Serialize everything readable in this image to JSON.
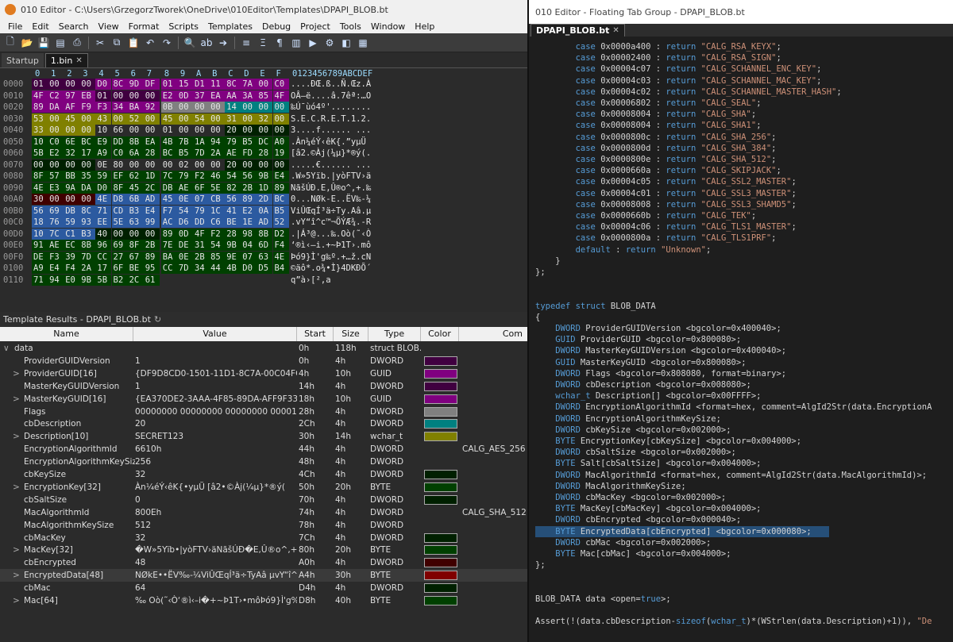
{
  "left": {
    "title": "010 Editor - C:\\Users\\GrzegorzTworek\\OneDrive\\010Editor\\Templates\\DPAPI_BLOB.bt",
    "menu": [
      "File",
      "Edit",
      "Search",
      "View",
      "Format",
      "Scripts",
      "Templates",
      "Debug",
      "Project",
      "Tools",
      "Window",
      "Help"
    ],
    "tabs": [
      {
        "label": "Startup"
      },
      {
        "label": "1.bin"
      }
    ],
    "close_glyph": "✕",
    "hex_header_cols": [
      "0",
      "1",
      "2",
      "3",
      "4",
      "5",
      "6",
      "7",
      "8",
      "9",
      "A",
      "B",
      "C",
      "D",
      "E",
      "F"
    ],
    "ascii_header": "0123456789ABCDEF",
    "hex_rows": [
      {
        "addr": "0000",
        "bytes": [
          "01",
          "00",
          "00",
          "00",
          "D0",
          "8C",
          "9D",
          "DF",
          "01",
          "15",
          "D1",
          "11",
          "8C",
          "7A",
          "00",
          "C0"
        ],
        "ascii": "....ÐŒ.ß..Ñ.Œz.À"
      },
      {
        "addr": "0010",
        "bytes": [
          "4F",
          "C2",
          "97",
          "EB",
          "01",
          "00",
          "00",
          "00",
          "E2",
          "0D",
          "37",
          "EA",
          "AA",
          "3A",
          "85",
          "4F"
        ],
        "ascii": "OÂ—ë....â.7êª:…O"
      },
      {
        "addr": "0020",
        "bytes": [
          "89",
          "DA",
          "AF",
          "F9",
          "F3",
          "34",
          "BA",
          "92",
          "0B",
          "00",
          "00",
          "00",
          "14",
          "00",
          "00",
          "00"
        ],
        "ascii": "‰Ú¯ùó4º'........"
      },
      {
        "addr": "0030",
        "bytes": [
          "53",
          "00",
          "45",
          "00",
          "43",
          "00",
          "52",
          "00",
          "45",
          "00",
          "54",
          "00",
          "31",
          "00",
          "32",
          "00"
        ],
        "ascii": "S.E.C.R.E.T.1.2."
      },
      {
        "addr": "0040",
        "bytes": [
          "33",
          "00",
          "00",
          "00",
          "10",
          "66",
          "00",
          "00",
          "01",
          "00",
          "00",
          "00",
          "20",
          "00",
          "00",
          "00"
        ],
        "ascii": "3....f...... ..."
      },
      {
        "addr": "0050",
        "bytes": [
          "10",
          "C0",
          "6E",
          "BC",
          "E9",
          "DD",
          "8B",
          "EA",
          "4B",
          "7B",
          "1A",
          "94",
          "79",
          "B5",
          "DC",
          "A0"
        ],
        "ascii": ".Àn¼éÝ‹êK{.”yµÜ "
      },
      {
        "addr": "0060",
        "bytes": [
          "5B",
          "E2",
          "32",
          "17",
          "A9",
          "C0",
          "6A",
          "28",
          "BC",
          "B5",
          "7D",
          "2A",
          "AE",
          "FD",
          "28",
          "19"
        ],
        "ascii": "[â2.©Àj(¼µ}*®ý(."
      },
      {
        "addr": "0070",
        "bytes": [
          "00",
          "00",
          "00",
          "00",
          "0E",
          "80",
          "00",
          "00",
          "00",
          "02",
          "00",
          "00",
          "20",
          "00",
          "00",
          "00"
        ],
        "ascii": ".....€...... ..."
      },
      {
        "addr": "0080",
        "bytes": [
          "8F",
          "57",
          "BB",
          "35",
          "59",
          "EF",
          "62",
          "1D",
          "7C",
          "79",
          "F2",
          "46",
          "54",
          "56",
          "9B",
          "E4"
        ],
        "ascii": ".W»5Yïb.|yòFTV›ä"
      },
      {
        "addr": "0090",
        "bytes": [
          "4E",
          "E3",
          "9A",
          "DA",
          "D0",
          "8F",
          "45",
          "2C",
          "DB",
          "AE",
          "6F",
          "5E",
          "82",
          "2B",
          "1D",
          "89"
        ],
        "ascii": "NãšÚÐ.E,Û®o^‚+.‰"
      },
      {
        "addr": "00A0",
        "bytes": [
          "30",
          "00",
          "00",
          "00",
          "4E",
          "D8",
          "6B",
          "AD",
          "45",
          "0E",
          "07",
          "CB",
          "56",
          "89",
          "2D",
          "BC"
        ],
        "ascii": "0...NØk-E..ËV‰-¼"
      },
      {
        "addr": "00B0",
        "bytes": [
          "56",
          "69",
          "DB",
          "8C",
          "71",
          "CD",
          "B3",
          "E4",
          "F7",
          "54",
          "79",
          "1C",
          "41",
          "E2",
          "0A",
          "B5"
        ],
        "ascii": "ViÛŒqÍ³ä÷Ty.Aâ.µ"
      },
      {
        "addr": "00C0",
        "bytes": [
          "18",
          "76",
          "59",
          "93",
          "EE",
          "5E",
          "63",
          "99",
          "AC",
          "D6",
          "DD",
          "C6",
          "BE",
          "1E",
          "AD",
          "52"
        ],
        "ascii": ".vY“î^c™¬ÖÝÆ¾.-R"
      },
      {
        "addr": "00D0",
        "bytes": [
          "10",
          "7C",
          "C1",
          "B3",
          "40",
          "00",
          "00",
          "00",
          "89",
          "0D",
          "4F",
          "F2",
          "28",
          "98",
          "8B",
          "D2"
        ],
        "ascii": ".|Á³@...‰.Oò(˜‹Ò"
      },
      {
        "addr": "00E0",
        "bytes": [
          "91",
          "AE",
          "EC",
          "8B",
          "96",
          "69",
          "8F",
          "2B",
          "7E",
          "DE",
          "31",
          "54",
          "9B",
          "04",
          "6D",
          "F4"
        ],
        "ascii": "‘®ì‹–i.+~Þ1T›.mô"
      },
      {
        "addr": "00F0",
        "bytes": [
          "DE",
          "F3",
          "39",
          "7D",
          "CC",
          "27",
          "67",
          "89",
          "BA",
          "0E",
          "2B",
          "85",
          "9E",
          "07",
          "63",
          "4E"
        ],
        "ascii": "Þó9}Ì'g‰º.+…ž.cN"
      },
      {
        "addr": "0100",
        "bytes": [
          "A9",
          "E4",
          "F4",
          "2A",
          "17",
          "6F",
          "BE",
          "95",
          "CC",
          "7D",
          "34",
          "44",
          "4B",
          "D0",
          "D5",
          "B4"
        ],
        "ascii": "©äô*.o¾•Ì}4DKÐÕ´"
      },
      {
        "addr": "0110",
        "bytes": [
          "71",
          "94",
          "E0",
          "9B",
          "5B",
          "B2",
          "2C",
          "61"
        ],
        "ascii": "q”à›[²,a"
      }
    ],
    "results_title": "Template Results - DPAPI_BLOB.bt",
    "results_headers": [
      "Name",
      "Value",
      "Start",
      "Size",
      "Type",
      "Color",
      "Com"
    ],
    "results_rows": [
      {
        "name": "data",
        "value": "",
        "start": "0h",
        "size": "118h",
        "type": "struct BLOB...",
        "color": "",
        "comment": "",
        "tw": "∨",
        "indent": 0
      },
      {
        "name": "ProviderGUIDVersion",
        "value": "1",
        "start": "0h",
        "size": "4h",
        "type": "DWORD",
        "color": "#400040",
        "comment": "",
        "tw": "",
        "indent": 1
      },
      {
        "name": "ProviderGUID[16]",
        "value": "{DF9D8CD0-1501-11D1-8C7A-00C04FC297EB}",
        "start": "4h",
        "size": "10h",
        "type": "GUID",
        "color": "#800080",
        "comment": "",
        "tw": ">",
        "indent": 1
      },
      {
        "name": "MasterKeyGUIDVersion",
        "value": "1",
        "start": "14h",
        "size": "4h",
        "type": "DWORD",
        "color": "#400040",
        "comment": "",
        "tw": "",
        "indent": 1
      },
      {
        "name": "MasterKeyGUID[16]",
        "value": "{EA370DE2-3AAA-4F85-89DA-AFF9F334BA92}",
        "start": "18h",
        "size": "10h",
        "type": "GUID",
        "color": "#800080",
        "comment": "",
        "tw": ">",
        "indent": 1
      },
      {
        "name": "Flags",
        "value": "00000000 00000000 00000000 00001011,b",
        "start": "28h",
        "size": "4h",
        "type": "DWORD",
        "color": "#808080",
        "comment": "",
        "tw": "",
        "indent": 1
      },
      {
        "name": "cbDescription",
        "value": "20",
        "start": "2Ch",
        "size": "4h",
        "type": "DWORD",
        "color": "#008080",
        "comment": "",
        "tw": "",
        "indent": 1
      },
      {
        "name": "Description[10]",
        "value": "SECRET123",
        "start": "30h",
        "size": "14h",
        "type": "wchar_t",
        "color": "#808000",
        "comment": "",
        "tw": ">",
        "indent": 1
      },
      {
        "name": "EncryptionAlgorithmId",
        "value": "6610h",
        "start": "44h",
        "size": "4h",
        "type": "DWORD",
        "color": "",
        "comment": "CALG_AES_256",
        "tw": "",
        "indent": 1
      },
      {
        "name": "EncryptionAlgorithmKeySize",
        "value": "256",
        "start": "48h",
        "size": "4h",
        "type": "DWORD",
        "color": "",
        "comment": "",
        "tw": "",
        "indent": 1
      },
      {
        "name": "cbKeySize",
        "value": "32",
        "start": "4Ch",
        "size": "4h",
        "type": "DWORD",
        "color": "#002000",
        "comment": "",
        "tw": "",
        "indent": 1
      },
      {
        "name": "EncryptionKey[32]",
        "value": "Àn¼éÝ‹êK{•yµÜ [â2•©Àj(¼µ}*®ý(",
        "start": "50h",
        "size": "20h",
        "type": "BYTE",
        "color": "#004000",
        "comment": "",
        "tw": ">",
        "indent": 1
      },
      {
        "name": "cbSaltSize",
        "value": "0",
        "start": "70h",
        "size": "4h",
        "type": "DWORD",
        "color": "#002000",
        "comment": "",
        "tw": "",
        "indent": 1
      },
      {
        "name": "MacAlgorithmId",
        "value": "800Eh",
        "start": "74h",
        "size": "4h",
        "type": "DWORD",
        "color": "",
        "comment": "CALG_SHA_512",
        "tw": "",
        "indent": 1
      },
      {
        "name": "MacAlgorithmKeySize",
        "value": "512",
        "start": "78h",
        "size": "4h",
        "type": "DWORD",
        "color": "",
        "comment": "",
        "tw": "",
        "indent": 1
      },
      {
        "name": "cbMacKey",
        "value": "32",
        "start": "7Ch",
        "size": "4h",
        "type": "DWORD",
        "color": "#002000",
        "comment": "",
        "tw": "",
        "indent": 1
      },
      {
        "name": "MacKey[32]",
        "value": "�W»5Yïb•|yòFTV›äNãšÚÐ�E,Û®o^‚+•‰",
        "start": "80h",
        "size": "20h",
        "type": "BYTE",
        "color": "#004000",
        "comment": "",
        "tw": ">",
        "indent": 1
      },
      {
        "name": "cbEncrypted",
        "value": "48",
        "start": "A0h",
        "size": "4h",
        "type": "DWORD",
        "color": "#400000",
        "comment": "",
        "tw": "",
        "indent": 1
      },
      {
        "name": "EncryptedData[48]",
        "value": "NØkE••ËV‰-¼ViÛŒqÍ³ä÷TyAâ µvY“î^...",
        "start": "A4h",
        "size": "30h",
        "type": "BYTE",
        "color": "#800000",
        "comment": "",
        "tw": ">",
        "indent": 1
      },
      {
        "name": "cbMac",
        "value": "64",
        "start": "D4h",
        "size": "4h",
        "type": "DWORD",
        "color": "#002000",
        "comment": "",
        "tw": "",
        "indent": 1
      },
      {
        "name": "Mac[64]",
        "value": "‰ Oò(˜‹Ò‘®ì‹–i�+~Þ1T›•môÞó9}Ì'g‰º•+...",
        "start": "D8h",
        "size": "40h",
        "type": "BYTE",
        "color": "#004000",
        "comment": "",
        "tw": ">",
        "indent": 1
      }
    ]
  },
  "right": {
    "title": "010 Editor - Floating Tab Group - DPAPI_BLOB.bt",
    "tab": "DPAPI_BLOB.bt",
    "code_lines": [
      "        case 0x0000a400 : return \"CALG_RSA_KEYX\";",
      "        case 0x00002400 : return \"CALG_RSA_SIGN\";",
      "        case 0x00004c07 : return \"CALG_SCHANNEL_ENC_KEY\";",
      "        case 0x00004c03 : return \"CALG_SCHANNEL_MAC_KEY\";",
      "        case 0x00004c02 : return \"CALG_SCHANNEL_MASTER_HASH\";",
      "        case 0x00006802 : return \"CALG_SEAL\";",
      "        case 0x00008004 : return \"CALG_SHA\";",
      "        case 0x00008004 : return \"CALG_SHA1\";",
      "        case 0x0000800c : return \"CALG_SHA_256\";",
      "        case 0x0000800d : return \"CALG_SHA_384\";",
      "        case 0x0000800e : return \"CALG_SHA_512\";",
      "        case 0x0000660a : return \"CALG_SKIPJACK\";",
      "        case 0x00004c05 : return \"CALG_SSL2_MASTER\";",
      "        case 0x00004c01 : return \"CALG_SSL3_MASTER\";",
      "        case 0x00008008 : return \"CALG_SSL3_SHAMD5\";",
      "        case 0x0000660b : return \"CALG_TEK\";",
      "        case 0x00004c06 : return \"CALG_TLS1_MASTER\";",
      "        case 0x0000800a : return \"CALG_TLS1PRF\";",
      "        default : return \"Unknown\";",
      "    }",
      "};",
      "",
      "",
      "typedef struct BLOB_DATA",
      "{",
      "    DWORD ProviderGUIDVersion <bgcolor=0x400040>;",
      "    GUID ProviderGUID <bgcolor=0x800080>;",
      "    DWORD MasterKeyGUIDVersion <bgcolor=0x400040>;",
      "    GUID MasterKeyGUID <bgcolor=0x800080>;",
      "    DWORD Flags <bgcolor=0x808080, format=binary>;",
      "    DWORD cbDescription <bgcolor=0x008080>;",
      "    wchar_t Description[] <bgcolor=0x00FFFF>;",
      "    DWORD EncryptionAlgorithmId <format=hex, comment=AlgId2Str(data.EncryptionA",
      "    DWORD EncryptionAlgorithmKeySize;",
      "    DWORD cbKeySize <bgcolor=0x002000>;",
      "    BYTE EncryptionKey[cbKeySize] <bgcolor=0x004000>;",
      "    DWORD cbSaltSize <bgcolor=0x002000>;",
      "    BYTE Salt[cbSaltSize] <bgcolor=0x004000>;",
      "    DWORD MacAlgorithmId <format=hex, comment=AlgId2Str(data.MacAlgorithmId)>;",
      "    DWORD MacAlgorithmKeySize;",
      "    DWORD cbMacKey <bgcolor=0x002000>;",
      "    BYTE MacKey[cbMacKey] <bgcolor=0x004000>;",
      "    DWORD cbEncrypted <bgcolor=0x000040>;",
      "    BYTE EncryptedData[cbEncrypted] <bgcolor=0x000080>;",
      "    DWORD cbMac <bgcolor=0x002000>;",
      "    BYTE Mac[cbMac] <bgcolor=0x004000>;",
      "};",
      "",
      "",
      "BLOB_DATA data <open=true>;",
      "",
      "Assert(!(data.cbDescription-sizeof(wchar_t)*(WStrlen(data.Description)+1)), \"De"
    ]
  }
}
